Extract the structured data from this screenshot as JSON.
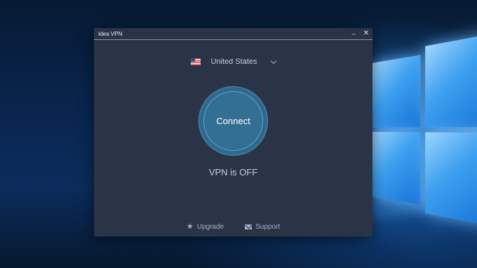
{
  "window": {
    "title": "Idea VPN",
    "minimize_glyph": "–",
    "close_glyph": "✕"
  },
  "location": {
    "country": "United States",
    "flag_icon": "us-flag-icon"
  },
  "connect": {
    "label": "Connect"
  },
  "status": {
    "text": "VPN is OFF"
  },
  "footer": {
    "upgrade_label": "Upgrade",
    "support_label": "Support",
    "upgrade_icon": "★"
  },
  "colors": {
    "window_bg": "#2b3447",
    "button_fill": "#336f93",
    "button_ring": "#5aa7c9"
  }
}
